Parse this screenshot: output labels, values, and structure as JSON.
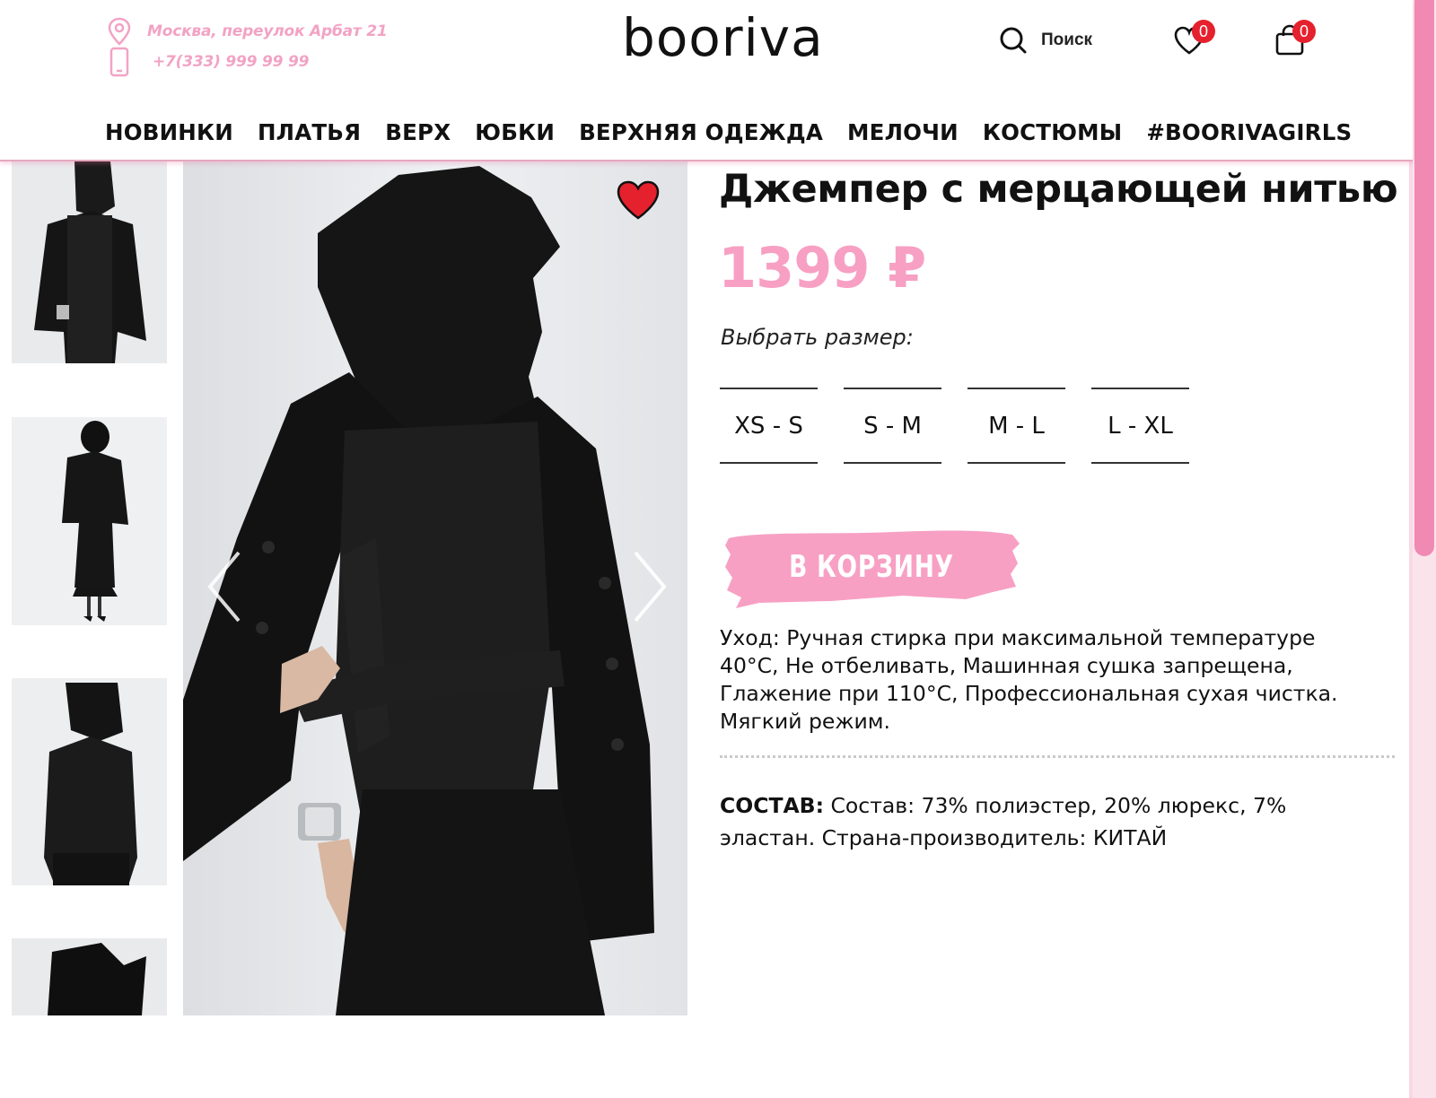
{
  "header": {
    "address": "Москва, переулок Арбат 21",
    "phone": "+7(333) 999 99 99",
    "logo": "booriva",
    "search_label": "Поиск",
    "favorites_count": "0",
    "cart_count": "0",
    "icons": {
      "address": "map-pin-icon",
      "phone": "smartphone-icon",
      "search": "search-icon",
      "favorites": "heart-icon",
      "cart": "shopping-bag-icon"
    }
  },
  "nav": {
    "items": [
      "НОВИНКИ",
      "ПЛАТЬЯ",
      "ВЕРХ",
      "ЮБКИ",
      "ВЕРХНЯЯ ОДЕЖДА",
      "МЕЛОЧИ",
      "КОСТЮМЫ",
      "#BOORIVAGIRLS"
    ]
  },
  "product": {
    "title": "Джемпер с мерцающей нитью",
    "price": "1399 ₽",
    "size_label": "Выбрать размер:",
    "sizes": [
      "XS - S",
      "S - M",
      "M - L",
      "L - XL"
    ],
    "cart_button": "В КОРЗИНУ",
    "care_text": "Уход: Ручная стирка при максимальной температуре 40°C, Не отбеливать, Машинная сушка запрещена, Глажение при 110°C, Профессиональная сухая чистка. Мягкий режим.",
    "composition_label": "СОСТАВ:",
    "composition_text": "Состав: 73% полиэстер, 20% люрекс, 7% эластан. Страна-производитель: КИТАЙ"
  },
  "colors": {
    "accent_pink": "#f7a0c4",
    "contact_pink": "#f2a3c4",
    "badge_red": "#e5212d",
    "favorite_heart": "#e5212d"
  }
}
